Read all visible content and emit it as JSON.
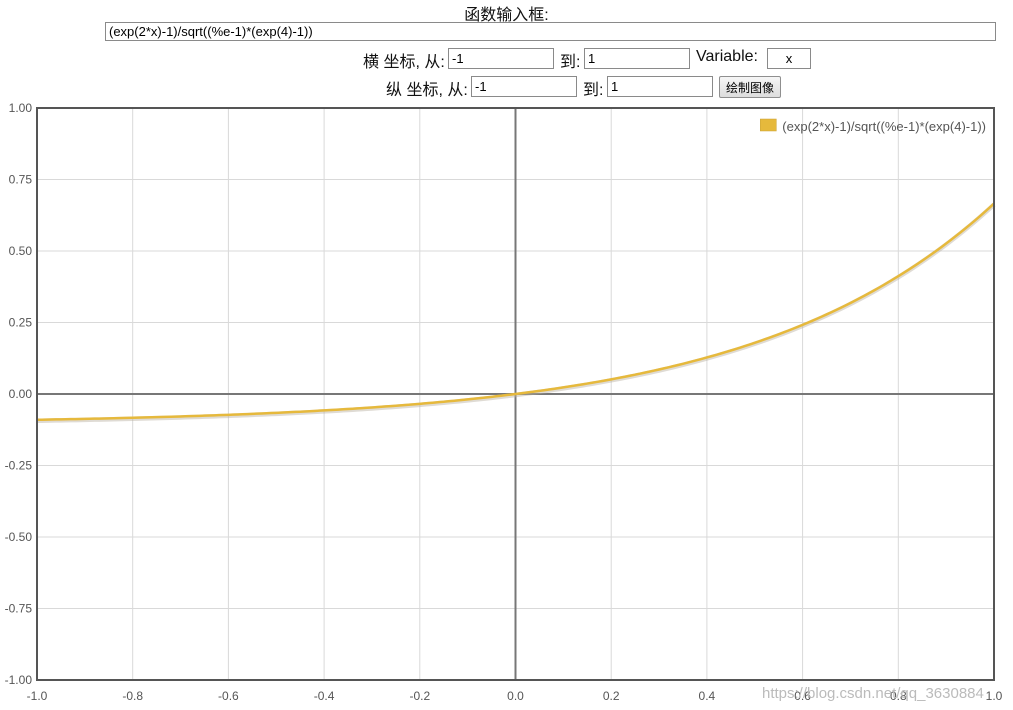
{
  "form": {
    "title": "函数输入框:",
    "function_value": "(exp(2*x)-1)/sqrt((%e-1)*(exp(4)-1))",
    "x_axis_label": "横 坐标, 从:",
    "x_from": "-1",
    "x_to_label": "到:",
    "x_to": "1",
    "variable_label": "Variable:",
    "variable_value": "x",
    "y_axis_label": "纵 坐标, 从:",
    "y_from": "-1",
    "y_to_label": "到:",
    "y_to": "1",
    "plot_button": "绘制图像"
  },
  "chart_data": {
    "type": "line",
    "series": [
      {
        "name": "(exp(2*x)-1)/sqrt((%e-1)*(exp(4)-1))",
        "color": "#e6b93c",
        "expression": "(exp(2*x)-1)/sqrt((e-1)*(exp(4)-1))",
        "x": [
          -1.0,
          -0.8,
          -0.6,
          -0.4,
          -0.2,
          0.0,
          0.2,
          0.4,
          0.6,
          0.8,
          1.0
        ],
        "y": [
          -0.0901,
          -0.0834,
          -0.0729,
          -0.0572,
          -0.034,
          0.0,
          0.0504,
          0.1257,
          0.2378,
          0.405,
          0.6545
        ]
      }
    ],
    "xlim": [
      -1,
      1
    ],
    "ylim": [
      -1,
      1
    ],
    "x_ticks": [
      "-1.0",
      "-0.8",
      "-0.6",
      "-0.4",
      "-0.2",
      "0.0",
      "0.2",
      "0.4",
      "0.6",
      "0.8",
      "1.0"
    ],
    "y_ticks": [
      "1.00",
      "0.75",
      "0.50",
      "0.25",
      "0.00",
      "-0.25",
      "-0.50",
      "-0.75",
      "-1.00"
    ],
    "grid": true,
    "legend_position": "top-right",
    "axis_color": "#777777",
    "grid_color": "#d9d9d9"
  },
  "watermark": "https://blog.csdn.net/qq_3630884"
}
